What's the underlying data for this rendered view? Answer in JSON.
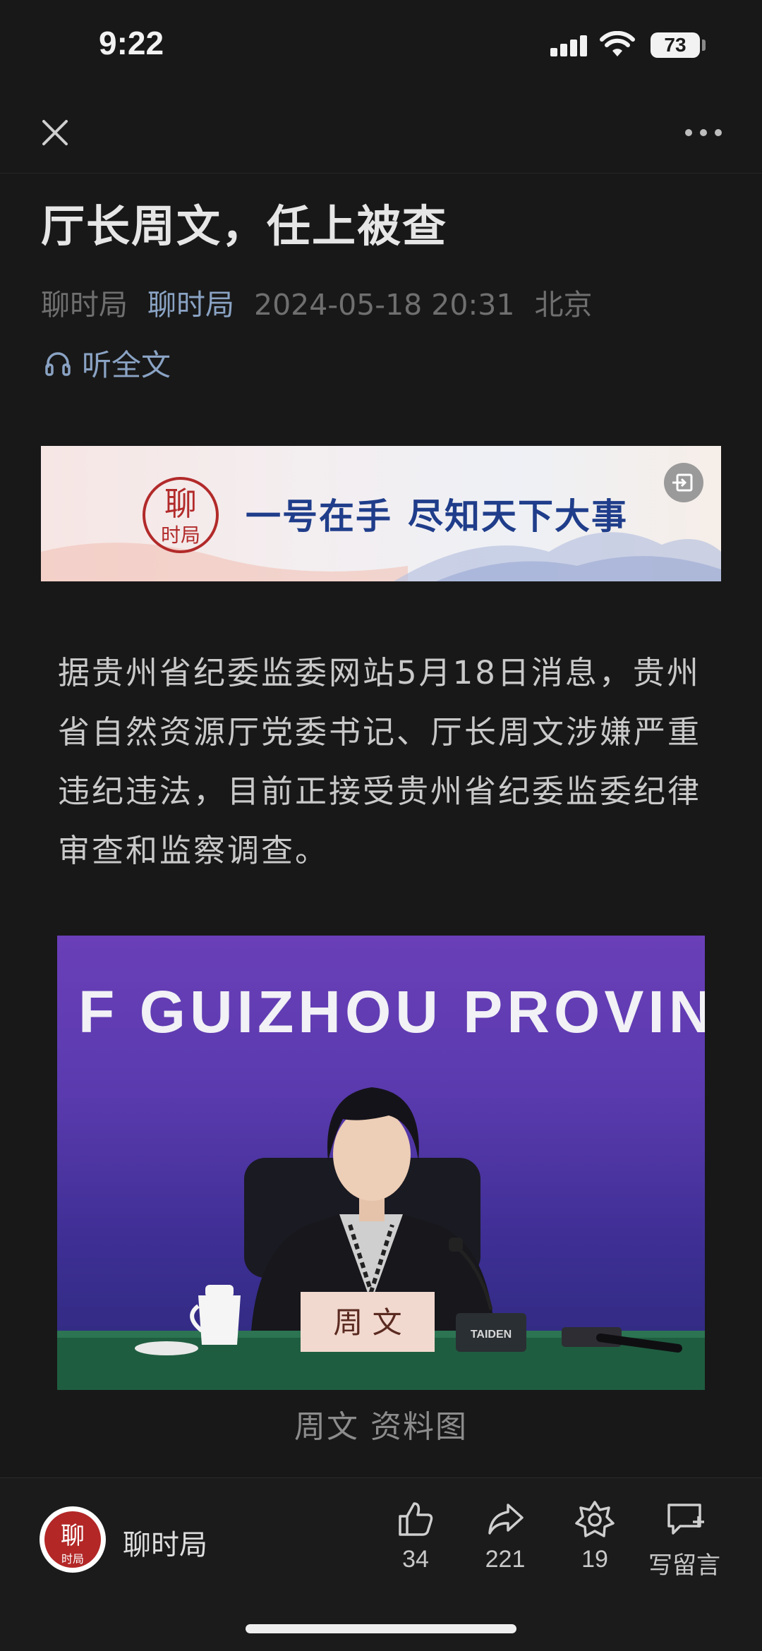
{
  "status": {
    "time": "9:22",
    "battery": "73"
  },
  "article": {
    "title": "厅长周文，任上被查",
    "source": "聊时局",
    "author": "聊时局",
    "date": "2024-05-18 20:31",
    "location": "北京",
    "listen_label": "听全文",
    "body": "据贵州省纪委监委网站5月18日消息，贵州省自然资源厅党委书记、厅长周文涉嫌严重违纪违法，目前正接受贵州省纪委监委纪律审查和监察调查。",
    "photo_banner_text": "F GUIZHOU PROVINCIA",
    "nameplate": "周 文",
    "mic_brand": "TAIDEN",
    "caption": "周文 资料图"
  },
  "banner": {
    "logo_text": "聊时局",
    "slogan_part1": "一号在手",
    "slogan_part2": "尽知天下大事"
  },
  "bottom_bar": {
    "name": "聊时局",
    "like_count": "34",
    "share_count": "221",
    "favorite_count": "19",
    "comment_label": "写留言"
  },
  "icons": [
    "close-icon",
    "more-icon",
    "headphones-icon",
    "exit-icon",
    "like-icon",
    "share-icon",
    "favorite-icon",
    "comment-icon"
  ]
}
